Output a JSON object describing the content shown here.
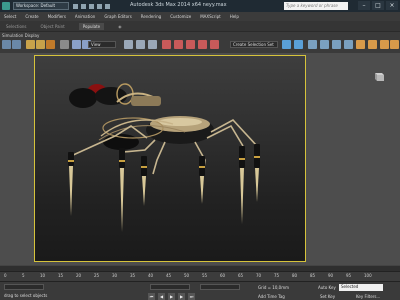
{
  "titlebar": {
    "workspace": "Workspace: Default",
    "title": "Autodesk 3ds Max 2014 x64    neyy.max",
    "search_placeholder": "Type a keyword or phrase",
    "minimize": "–",
    "maximize": "□",
    "close": "×"
  },
  "menu": [
    "Select",
    "Create",
    "Modifiers",
    "Animation",
    "Graph Editors",
    "Rendering",
    "Customize",
    "MAXScript",
    "Help"
  ],
  "ribbon": {
    "tabs": [
      "Selections",
      "Object Paint",
      "Populate"
    ],
    "active_index": 2
  },
  "toolbar": {
    "left_labels": "Simulation  Display",
    "view_dropdown": "View",
    "selection_set": "Create Selection Set"
  },
  "viewport": {
    "label": ""
  },
  "timeline": {
    "ticks": [
      "0",
      "5",
      "10",
      "15",
      "20",
      "25",
      "30",
      "35",
      "40",
      "45",
      "50",
      "55",
      "60",
      "65",
      "70",
      "75",
      "80",
      "85",
      "90",
      "95",
      "100"
    ]
  },
  "status": {
    "prompt": "drag to select objects",
    "grid": "Grid = 10,0mm",
    "add_time_tag": "Add Time Tag",
    "autokey": "Auto Key",
    "setkey": "Set Key",
    "selected": "Selected",
    "key_filters": "Key Filters..."
  },
  "colors": {
    "viewport_border": "#d6c33b",
    "accent": "#3b9a8e"
  }
}
